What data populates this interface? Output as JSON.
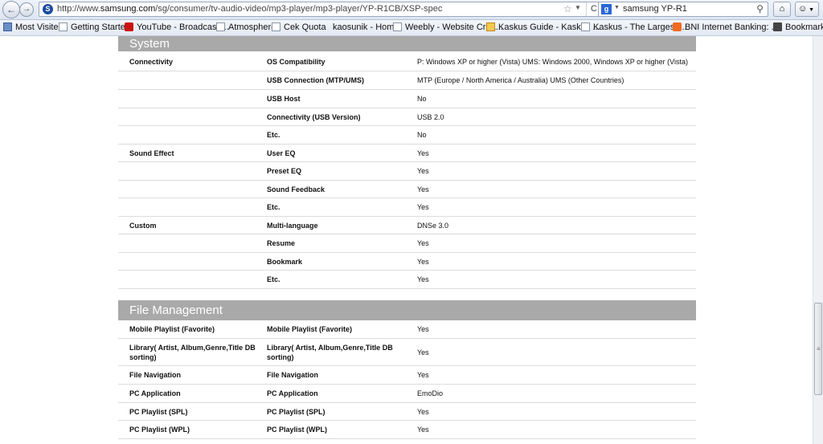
{
  "browser": {
    "url_prefix": "http://www.",
    "url_domain": "samsung.com",
    "url_path": "/sg/consumer/tv-audio-video/mp3-player/mp3-player/YP-R1CB/XSP-spec",
    "search_text": "samsung YP-R1",
    "back_icon": "←",
    "forward_icon": "→",
    "reload_icon": "C",
    "star_icon": "☆",
    "search_icon": "⚲",
    "home_icon": "⌂",
    "bookmarks": [
      {
        "label": "Most Visited",
        "icon": "grid"
      },
      {
        "label": "Getting Started",
        "icon": "page"
      },
      {
        "label": "YouTube - Broadcast ...",
        "icon": "youtube"
      },
      {
        "label": "Atmosphere",
        "icon": "page"
      },
      {
        "label": "Cek Quota",
        "icon": "page"
      },
      {
        "label": "kaosunik - Home",
        "icon": "none"
      },
      {
        "label": "Weebly - Website Crea...",
        "icon": "page"
      },
      {
        "label": "Kaskus Guide - Kaskus ...",
        "icon": "mail"
      },
      {
        "label": "Kaskus - The Largest I...",
        "icon": "page"
      },
      {
        "label": "BNI Internet Banking: ...",
        "icon": "bni"
      }
    ],
    "bookmarks_menu": "Bookmarks"
  },
  "sections": [
    {
      "title": "System",
      "rows": [
        {
          "group": "Connectivity",
          "label": "OS Compatibility",
          "value": "P: Windows XP or higher (Vista) UMS: Windows 2000, Windows XP or higher (Vista)"
        },
        {
          "group": "",
          "label": "USB Connection (MTP/UMS)",
          "value": "MTP (Europe / North America / Australia) UMS (Other Countries)"
        },
        {
          "group": "",
          "label": "USB Host",
          "value": "No"
        },
        {
          "group": "",
          "label": "Connectivity (USB Version)",
          "value": "USB 2.0"
        },
        {
          "group": "",
          "label": "Etc.",
          "value": "No"
        },
        {
          "group": "Sound Effect",
          "label": "User EQ",
          "value": "Yes"
        },
        {
          "group": "",
          "label": "Preset EQ",
          "value": "Yes"
        },
        {
          "group": "",
          "label": "Sound Feedback",
          "value": "Yes"
        },
        {
          "group": "",
          "label": "Etc.",
          "value": "Yes"
        },
        {
          "group": "Custom",
          "label": "Multi-language",
          "value": "DNSe 3.0"
        },
        {
          "group": "",
          "label": "Resume",
          "value": "Yes"
        },
        {
          "group": "",
          "label": "Bookmark",
          "value": "Yes"
        },
        {
          "group": "",
          "label": "Etc.",
          "value": "Yes"
        }
      ]
    },
    {
      "title": "File Management",
      "rows": [
        {
          "group": "Mobile Playlist (Favorite)",
          "label": "Mobile Playlist (Favorite)",
          "value": "Yes"
        },
        {
          "group": "Library( Artist, Album,Genre,Title DB sorting)",
          "label": "Library( Artist, Album,Genre,Title DB sorting)",
          "value": "Yes"
        },
        {
          "group": "File Navigation",
          "label": "File Navigation",
          "value": "Yes"
        },
        {
          "group": "PC Application",
          "label": "PC Application",
          "value": "EmoDio"
        },
        {
          "group": "PC Playlist (SPL)",
          "label": "PC Playlist (SPL)",
          "value": "Yes"
        },
        {
          "group": "PC Playlist (WPL)",
          "label": "PC Playlist (WPL)",
          "value": "Yes"
        }
      ]
    }
  ]
}
